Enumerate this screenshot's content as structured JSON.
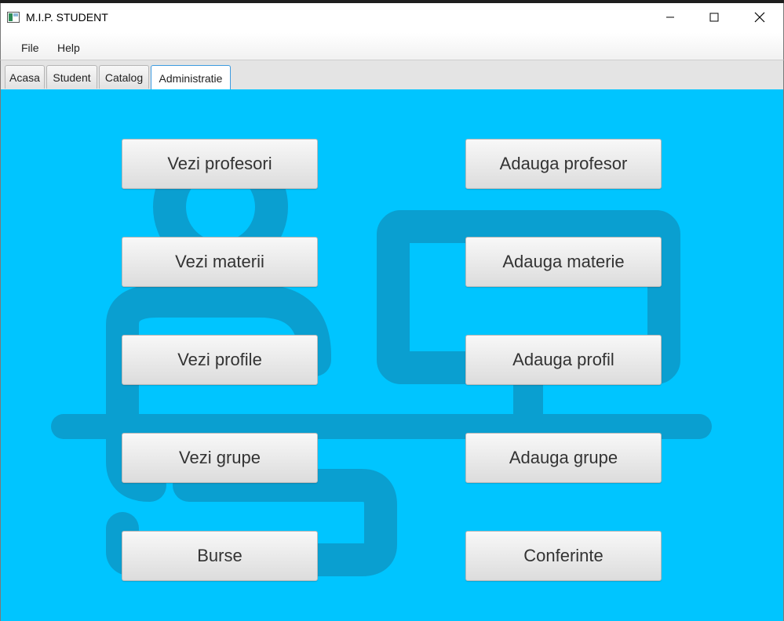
{
  "window": {
    "title": "M.I.P. STUDENT",
    "controls": [
      "minimize",
      "maximize",
      "close"
    ]
  },
  "menu": {
    "items": [
      {
        "label": "File"
      },
      {
        "label": "Help"
      }
    ]
  },
  "tabs": [
    {
      "label": "Acasa",
      "active": false
    },
    {
      "label": "Student",
      "active": false
    },
    {
      "label": "Catalog",
      "active": false
    },
    {
      "label": "Administratie",
      "active": true
    }
  ],
  "admin": {
    "view_buttons": [
      {
        "label": "Vezi profesori"
      },
      {
        "label": "Vezi materii"
      },
      {
        "label": "Vezi profile"
      },
      {
        "label": "Vezi grupe"
      },
      {
        "label": "Burse"
      }
    ],
    "add_buttons": [
      {
        "label": "Adauga profesor"
      },
      {
        "label": "Adauga materie"
      },
      {
        "label": "Adauga profil"
      },
      {
        "label": "Adauga grupe"
      },
      {
        "label": "Conferinte"
      }
    ]
  },
  "colors": {
    "background": "#00c5ff",
    "logo": "#0a9fd0",
    "active_tab_border": "#3d9be0"
  }
}
